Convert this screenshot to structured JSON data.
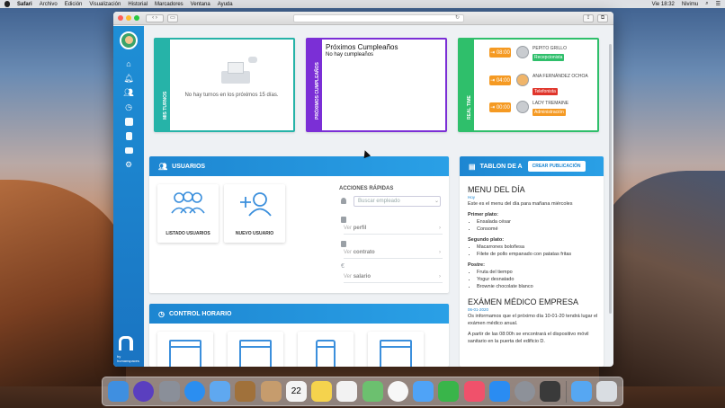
{
  "menubar": {
    "app": "Safari",
    "items": [
      "Archivo",
      "Edición",
      "Visualización",
      "Historial",
      "Marcadores",
      "Ventana",
      "Ayuda"
    ],
    "clock": "Vie 18:32",
    "user": "Nivimu"
  },
  "sidebar": {
    "icons": [
      "home-icon",
      "bell-icon",
      "users-icon",
      "clock-icon",
      "briefcase-icon",
      "document-icon",
      "id-card-icon",
      "gear-icon"
    ],
    "brand": "by humanspaces"
  },
  "turnos": {
    "tab_label": "MIS TURNOS",
    "message": "No hay turnos en los próximos 15 días."
  },
  "cumpleanos": {
    "tab_label": "PRÓXIMOS CUMPLEAÑOS",
    "title": "Próximos Cumpleaños",
    "message": "No hay cumpleaños"
  },
  "realtime": {
    "tab_label": "REAL TIME",
    "rows": [
      {
        "time": "08:00",
        "name": "PEPITO GRILLO",
        "tag": "Recepcionista",
        "tag_color": "#2fbf6b"
      },
      {
        "time": "04:00",
        "name": "ANA FERNÁNDEZ OCHOA",
        "tag": "Telefonista",
        "tag_color": "#e0352b"
      },
      {
        "time": "00:00",
        "name": "LADY TREMAINE",
        "tag": "Administración",
        "tag_color": "#f59a23"
      }
    ]
  },
  "usuarios": {
    "title": "USUARIOS",
    "tiles": [
      {
        "label": "LISTADO USUARIOS"
      },
      {
        "label": "NUEVO USUARIO"
      }
    ],
    "quick_actions": {
      "title": "ACCIONES RÁPIDAS",
      "search_placeholder": "Buscar empleado",
      "links": [
        {
          "prefix": "Ver",
          "target": "perfil"
        },
        {
          "prefix": "Ver",
          "target": "contrato"
        },
        {
          "prefix": "Ver",
          "target": "salario"
        }
      ]
    }
  },
  "control": {
    "title": "CONTROL HORARIO"
  },
  "tablon": {
    "title": "TABLON DE A",
    "button": "CREAR PUBLICACIÓN",
    "menu": {
      "heading": "MENU DEL DÍA",
      "date": "Hoy",
      "intro": "Este es el menu del día para mañana miércoles",
      "sections": [
        {
          "title": "Primer plato:",
          "items": [
            "Ensalada césar",
            "Consomé"
          ]
        },
        {
          "title": "Segundo plato:",
          "items": [
            "Macarrones boloñesa",
            "Filete de pollo empanado con patatas fritas"
          ]
        },
        {
          "title": "Postre:",
          "items": [
            "Fruta del tiempo",
            "Yogur desnatado",
            "Brownie chocolate blanco"
          ]
        }
      ]
    },
    "exam": {
      "heading": "EXÁMEN MÉDICO EMPRESA",
      "date": "06-01-2020",
      "text1": "Os informamos que el próximo día 10-01-20 tendrá lugar el exámen médico anual.",
      "text2": "A partir de las 08:00h se encontrará el dispositivo móvil sanitario en la puerta del edificio D."
    }
  },
  "dock": {
    "apps": [
      {
        "name": "finder-icon",
        "color": "#3f8fe0"
      },
      {
        "name": "siri-icon",
        "color": "#5a3fbf"
      },
      {
        "name": "launchpad-icon",
        "color": "#8a8f99"
      },
      {
        "name": "safari-icon",
        "color": "#2b8ef0"
      },
      {
        "name": "mail-icon",
        "color": "#5fa8f0"
      },
      {
        "name": "notes-brown-icon",
        "color": "#a0713b"
      },
      {
        "name": "contacts-icon",
        "color": "#c69c6d"
      },
      {
        "name": "calendar-icon",
        "color": "#f4f4f4"
      },
      {
        "name": "notes-icon",
        "color": "#f5d34d"
      },
      {
        "name": "reminders-icon",
        "color": "#f2f2f2"
      },
      {
        "name": "maps-icon",
        "color": "#6cc06f"
      },
      {
        "name": "photos-icon",
        "color": "#f7f7f7"
      },
      {
        "name": "messages-icon",
        "color": "#4fa3f7"
      },
      {
        "name": "facetime-icon",
        "color": "#39b54a"
      },
      {
        "name": "music-icon",
        "color": "#f0516b"
      },
      {
        "name": "appstore-icon",
        "color": "#2a8cf2"
      },
      {
        "name": "preferences-icon",
        "color": "#8d9199"
      },
      {
        "name": "photo-booth-icon",
        "color": "#3a3a3a"
      },
      {
        "name": "downloads-icon",
        "color": "#56a7f2"
      },
      {
        "name": "trash-icon",
        "color": "#d9dde2"
      }
    ],
    "calendar_day": "22"
  }
}
